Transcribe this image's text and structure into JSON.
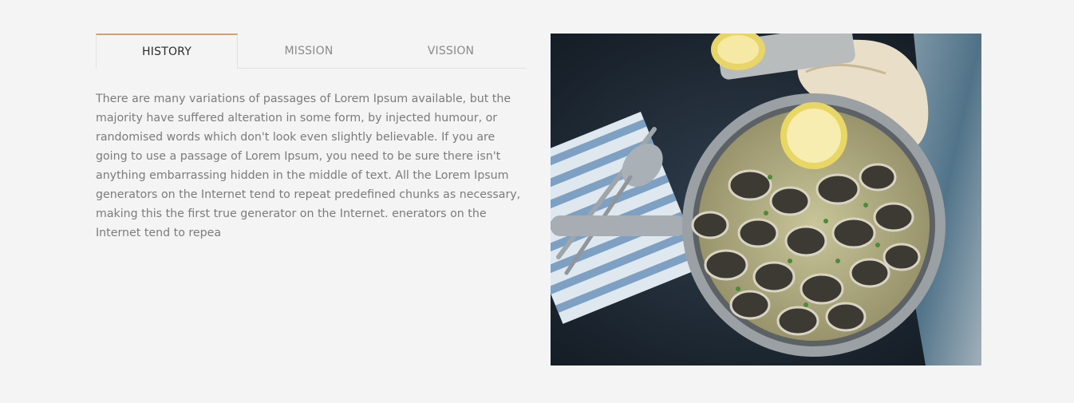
{
  "tabs": [
    {
      "label": "HISTORY",
      "active": true
    },
    {
      "label": "MISSION",
      "active": false
    },
    {
      "label": "VISSION",
      "active": false
    }
  ],
  "content": {
    "paragraph": "There are many variations of passages of Lorem Ipsum available, but the majority have suffered alteration in some form, by injected humour, or randomised words which don't look even slightly believable. If you are going to use a passage of Lorem Ipsum, you need to be sure there isn't anything embarrassing hidden in the middle of text. All the Lorem Ipsum generators on the Internet tend to repeat predefined chunks as necessary, making this the first true generator on the Internet. enerators on the Internet tend to repea"
  },
  "colors": {
    "background": "#f4f4f4",
    "active_tab_accent": "#d2a06b",
    "text": "#7b7b7b"
  }
}
